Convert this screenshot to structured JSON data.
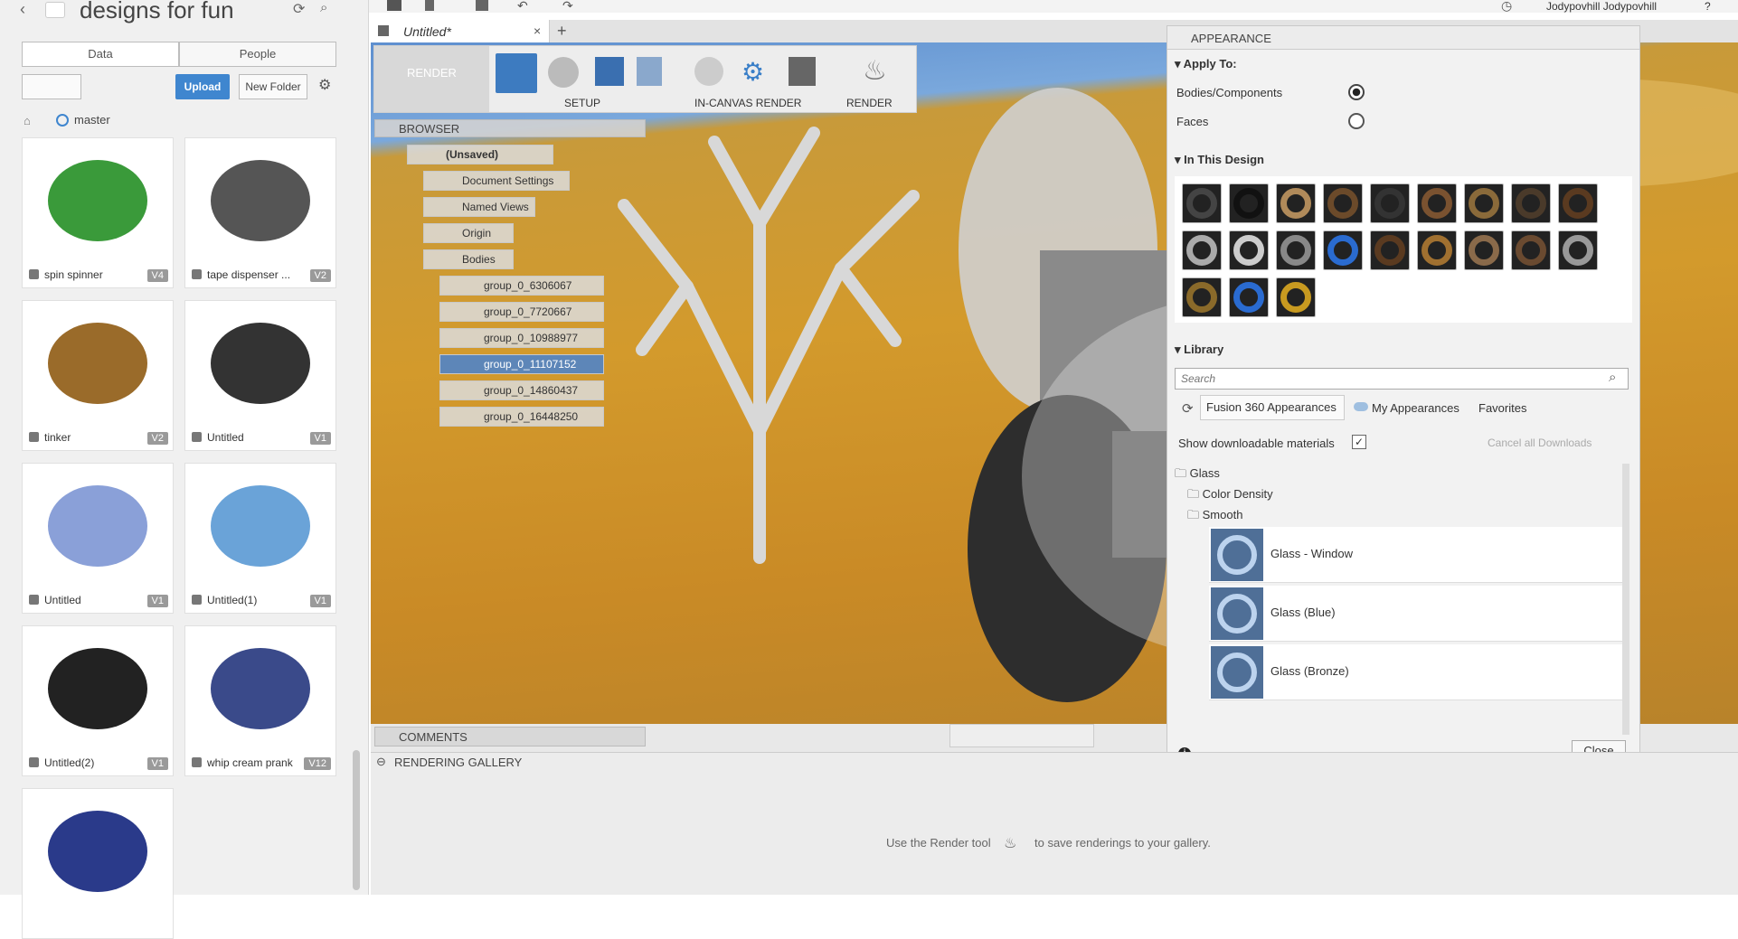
{
  "topbar": {
    "user": "Jodypovhill Jodypovhill",
    "help": "?"
  },
  "data_panel": {
    "project_title": "designs for fun",
    "tabs": [
      "Data",
      "People"
    ],
    "upload_label": "Upload",
    "new_folder_label": "New Folder",
    "branch": "master",
    "designs": [
      {
        "name": "spin spinner",
        "version": "V4",
        "color": "#3a9a3a"
      },
      {
        "name": "tape dispenser ...",
        "version": "V2",
        "color": "#555"
      },
      {
        "name": "tinker",
        "version": "V2",
        "color": "#9a6b2a"
      },
      {
        "name": "Untitled",
        "version": "V1",
        "color": "#333"
      },
      {
        "name": "Untitled",
        "version": "V1",
        "color": "#8aa0d8"
      },
      {
        "name": "Untitled(1)",
        "version": "V1",
        "color": "#6aa3d8"
      },
      {
        "name": "Untitled(2)",
        "version": "V1",
        "color": "#222"
      },
      {
        "name": "whip cream prank",
        "version": "V12",
        "color": "#3a4a8a"
      },
      {
        "name": "",
        "version": "",
        "color": "#2a3a8a"
      }
    ]
  },
  "document_tab": {
    "title": "Untitled*"
  },
  "toolbar": {
    "workspace": "RENDER",
    "groups": [
      "SETUP",
      "IN-CANVAS RENDER",
      "RENDER"
    ]
  },
  "browser": {
    "title": "BROWSER",
    "root": "(Unsaved)",
    "items": [
      "Document Settings",
      "Named Views",
      "Origin",
      "Bodies"
    ],
    "bodies": [
      "group_0_6306067",
      "group_0_7720667",
      "group_0_10988977",
      "group_0_11107152",
      "group_0_14860437",
      "group_0_16448250"
    ],
    "selected_body_index": 3
  },
  "comments_label": "COMMENTS",
  "appearance": {
    "title": "APPEARANCE",
    "apply_to": "Apply To:",
    "apply_options": [
      {
        "label": "Bodies/Components",
        "checked": true
      },
      {
        "label": "Faces",
        "checked": false
      }
    ],
    "in_this_design": "In This Design",
    "swatches": [
      "#444",
      "#111",
      "#b08a5a",
      "#6b4a2a",
      "#333",
      "#7a5230",
      "#8a6a3a",
      "#4a3a2a",
      "#5a3a20",
      "#aaa",
      "#ccc",
      "#888",
      "#2a6bd0",
      "#5a3a20",
      "#a07030",
      "#8a6a4a",
      "#6a4a30",
      "#999",
      "#8a6a2a",
      "#2a6bd0",
      "#c89a20"
    ],
    "library": "Library",
    "search_placeholder": "Search",
    "lib_tabs": [
      "Fusion 360 Appearances",
      "My Appearances",
      "Favorites"
    ],
    "show_downloadable": "Show downloadable materials",
    "cancel_downloads": "Cancel all Downloads",
    "tree": [
      "Glass",
      "Color Density",
      "Smooth"
    ],
    "materials": [
      "Glass - Window",
      "Glass (Blue)",
      "Glass (Bronze)"
    ],
    "close_label": "Close"
  },
  "gallery": {
    "title": "RENDERING GALLERY",
    "hint_prefix": "Use the Render tool",
    "hint_suffix": "to save renderings to your gallery."
  }
}
